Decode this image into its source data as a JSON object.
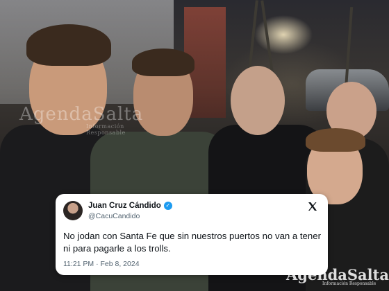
{
  "watermark": {
    "top_brand": "AgendaSalta",
    "top_tagline": "Información Responsable",
    "bottom_brand": "AgendaSalta",
    "bottom_tagline": "Información Responsable"
  },
  "tweet": {
    "display_name": "Juan Cruz Cándido",
    "verified_icon": "✓",
    "handle": "@CacuCandido",
    "text": "No jodan con Santa Fe que sin nuestros puertos no van a tener ni para pagarle a los trolls.",
    "timestamp": "11:21 PM · Feb 8, 2024",
    "brand_icon": "x-logo-icon"
  },
  "colors": {
    "verified": "#1d9bf0",
    "text": "#0f1419",
    "secondary_text": "#536471"
  }
}
